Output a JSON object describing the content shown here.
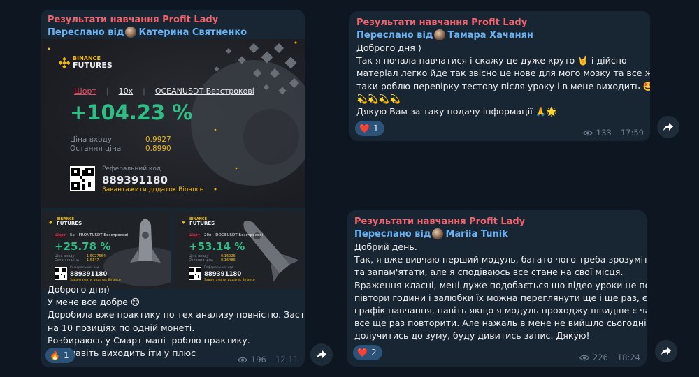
{
  "messages": [
    {
      "channel_title": "Результати навчання Profit Lady",
      "forwarded_prefix": "Переслано від",
      "forwarded_name": "Катерина Святненко",
      "images": {
        "main": {
          "logo_top": "BINANCE",
          "logo_bottom": "FUTURES",
          "side": "Шорт",
          "leverage": "10x",
          "pair": "OCEANUSDT Безстрокові",
          "pnl": "+104.23 %",
          "entry_label": "Ціна входу",
          "entry_value": "0.9927",
          "last_label": "Остання ціна",
          "last_value": "0.8990",
          "ref_label": "Реферальний код",
          "ref_code": "889391180",
          "download": "Завантажити додаток Binance"
        },
        "small1": {
          "logo_top": "BINANCE",
          "logo_bottom": "FUTURES",
          "side": "Шорт",
          "leverage": "5x",
          "pair": "FRONTUSDT Безстрокові",
          "pnl": "+25.78 %",
          "entry_label": "Ціна входу",
          "entry_value": "1.5927664",
          "last_label": "Остання ціна",
          "last_value": "1.5147",
          "ref_label": "Реферальний код",
          "ref_code": "889391180",
          "download": "Завантажити додаток Binance"
        },
        "small2": {
          "logo_top": "BINANCE",
          "logo_bottom": "FUTURES",
          "side": "Шорт",
          "leverage": "20x",
          "pair": "DOGEUSDT Безстрокові",
          "pnl": "+53.14 %",
          "entry_label": "Ціна входу",
          "entry_value": "0.16926",
          "last_label": "Остання ціна",
          "last_value": "0.16486",
          "ref_label": "Реферальний код",
          "ref_code": "889391180",
          "download": "Завантажити додаток Binance"
        }
      },
      "text_lines": [
        "Доброго дня)",
        "У мене все добре 😊",
        "Доробила вже практику по тех анализу повністю. Застрягла дуже",
        "на 10 позиціях по одній монеті.",
        "Розбираюсь у Смарт-мані- роблю практику.",
        "Вже навіть виходить іти у плюс"
      ],
      "reaction_emoji": "🔥",
      "reaction_count": "1",
      "views": "196",
      "time": "12:11"
    },
    {
      "channel_title": "Результати навчання Profit Lady",
      "forwarded_prefix": "Переслано від",
      "forwarded_name": "Тамара Хачанян",
      "text_lines": [
        "Доброго дня )",
        "Так я почала навчатися і скажу це дуже круто 🤘 і дійсно",
        "матеріал легко йде так звісно це нове для мого мозку та все ж",
        "таки роблю перевірку тестову після уроку і в мене виходить 🤩",
        "💫💫💫💫",
        "Дякую Вам за таку подачу інформації 🙏🌟"
      ],
      "reaction_emoji": "❤️",
      "reaction_count": "1",
      "views": "133",
      "time": "17:59"
    },
    {
      "channel_title": "Результати навчання Profit Lady",
      "forwarded_prefix": "Переслано від",
      "forwarded_name": "Mariia Tunik",
      "text_lines": [
        "Добрий день.",
        "Так, я вже вивчаю перший модуль, багато чого треба зрозуміти",
        "та запам'ятати, але я сподіваюсь все стане на свої місця.",
        "Враження класні, мені дуже подобається що відео уроки не по",
        "півтори години і залюбки їх можна переглянути ще і ще раз, є",
        "графік навчання, навіть якщо я модуль проходжу швидше є час",
        "все ще раз повторити. Але нажаль в мене не вийшло сьогодні",
        "долучитись  до зуму, буду дивитись запис. Дякую!"
      ],
      "reaction_emoji": "❤️",
      "reaction_count": "2",
      "views": "226",
      "time": "18:24"
    }
  ]
}
